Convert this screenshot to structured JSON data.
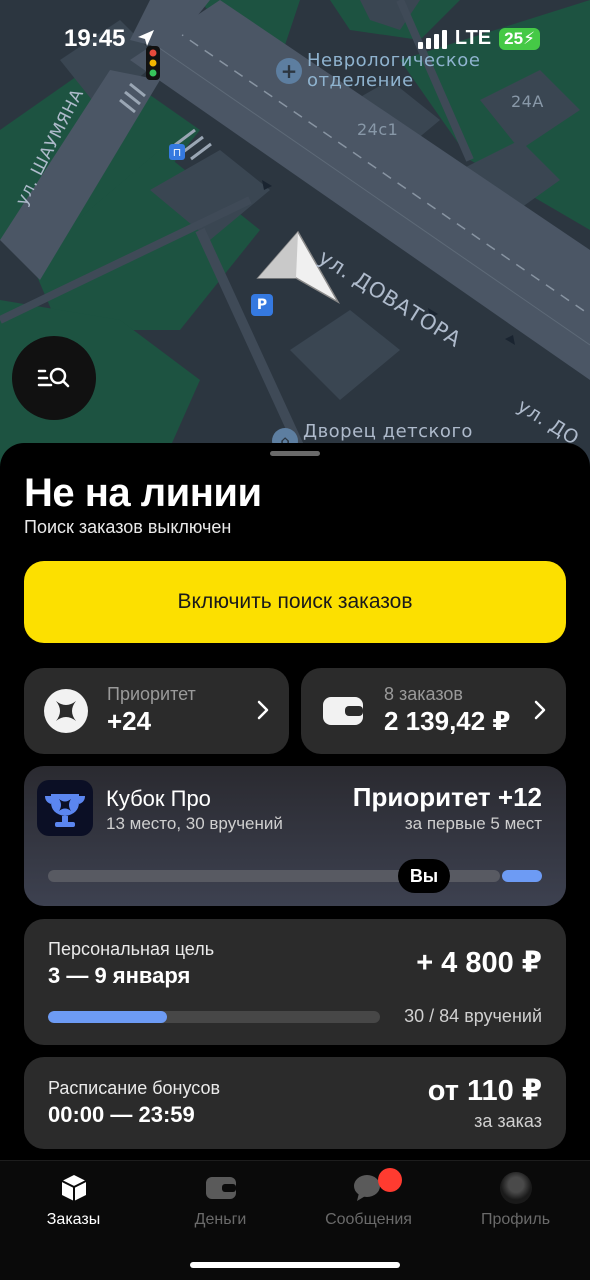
{
  "status_bar": {
    "time": "19:45",
    "network": "LTE",
    "battery": "25"
  },
  "map": {
    "street_1": "ул. ДОВАТОРА",
    "street_2": "ул. ШАУМЯНА",
    "street_3": "ул. ДО",
    "poi_1": "Неврологическое отделение",
    "building_1": "24А",
    "building_2": "24с1",
    "poi_2": "Дворец детского",
    "parking": "P",
    "bus_stop": "⊓"
  },
  "sheet": {
    "title": "Не на линии",
    "subtitle": "Поиск заказов выключен",
    "primary_button": "Включить поиск заказов",
    "priority": {
      "label": "Приоритет",
      "value": "+24"
    },
    "money": {
      "label": "8 заказов",
      "value": "2 139,42 ₽"
    },
    "cup": {
      "title": "Кубок Про",
      "subtitle": "13 место, 30 вручений",
      "reward": "Приоритет +12",
      "reward_note": "за первые 5 мест",
      "you_label": "Вы"
    },
    "goal": {
      "label": "Персональная цель",
      "dates": "3 — 9 января",
      "amount": "+ 4 800 ₽",
      "progress_text": "30 / 84 вручений",
      "progress_fraction": 0.357
    },
    "bonus": {
      "label": "Расписание бонусов",
      "time": "00:00 — 23:59",
      "amount": "от 110 ₽",
      "per": "за заказ"
    }
  },
  "tabs": [
    {
      "label": "Заказы",
      "active": true
    },
    {
      "label": "Деньги",
      "active": false
    },
    {
      "label": "Сообщения",
      "active": false
    },
    {
      "label": "Профиль",
      "active": false
    }
  ],
  "colors": {
    "accent_yellow": "#fce000",
    "progress_blue": "#6d9bf4",
    "badge_red": "#ff3b30",
    "card_bg": "#2b2b2b"
  }
}
